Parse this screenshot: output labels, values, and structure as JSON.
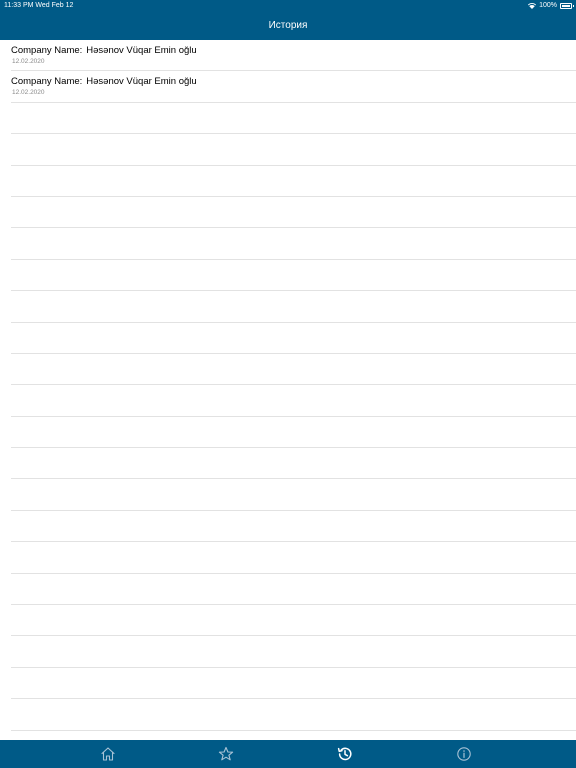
{
  "status_bar": {
    "time_date": "11:33 PM  Wed Feb 12",
    "battery": "100%",
    "battery_level": 1.0
  },
  "nav": {
    "title": "История"
  },
  "history": {
    "items": [
      {
        "label": "Company Name:",
        "company": "Həsənov Vüqar Emin oğlu",
        "date": "12.02.2020"
      },
      {
        "label": "Company Name:",
        "company": "Həsənov Vüqar Emin oğlu",
        "date": "12.02.2020"
      }
    ]
  },
  "tab_bar": {
    "tabs": [
      {
        "icon": "home-icon",
        "selected": false
      },
      {
        "icon": "star-icon",
        "selected": false
      },
      {
        "icon": "history-icon",
        "selected": true
      },
      {
        "icon": "info-icon",
        "selected": false
      }
    ],
    "selected_color": "#ffffff",
    "unselected_color": "#a9c3d6"
  },
  "colors": {
    "brand": "#005a87",
    "separator": "#e2e2e2",
    "subtitle": "#8a8a8a"
  }
}
